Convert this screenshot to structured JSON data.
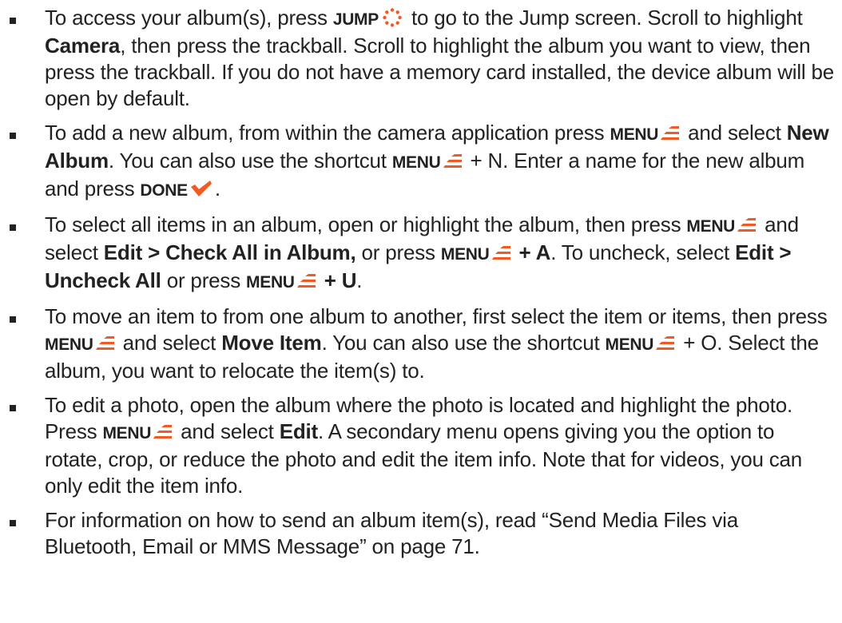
{
  "accent": "#f15a22",
  "icons": {
    "jump": "jump-dots-icon",
    "menu": "menu-lines-icon",
    "done": "checkmark-icon"
  },
  "bullets": [
    {
      "t1": "To access your album(s), press ",
      "k1": "JUMP",
      "t2": " to go to the Jump screen. Scroll to highlight ",
      "b1": "Camera",
      "t3": ", then press the trackball. Scroll to highlight the album you want to view, then press the trackball. If you do not have a memory card installed, the device album will be open by default."
    },
    {
      "t1": "To add a new album, from within the camera application press ",
      "k1": "MENU",
      "t2": " and select ",
      "b1": "New Album",
      "t3": ". You can also use the shortcut ",
      "k2": "MENU",
      "t4": " + N. Enter a name for the new album and  press ",
      "k3": "DONE",
      "t5": "."
    },
    {
      "t1": "To select all items in an album, open or highlight the album, then press ",
      "k1": "MENU",
      "t2": " and select ",
      "b1": "Edit > Check All in Album,",
      "t3": " or press ",
      "k2": "MENU",
      "b2": " + A",
      "t4": ". To uncheck, select ",
      "b3": "Edit > Uncheck All",
      "t5": " or press ",
      "k3": "MENU",
      "b4": " + U",
      "t6": "."
    },
    {
      "t1": "To move an item to from one album to another, first select the item or items,  then press ",
      "k1": "MENU",
      "t2": " and select ",
      "b1": "Move Item",
      "t3": ". You can also use the shortcut ",
      "k2": "MENU",
      "t4": " + O. Select the album, you want to relocate the item(s) to."
    },
    {
      "t1": "To edit a photo, open the album where the photo is located and highlight the photo. Press ",
      "k1": "MENU",
      "t2": " and select ",
      "b1": "Edit",
      "t3": ". A secondary menu opens giving you the option to rotate, crop, or reduce the photo and edit the item info. Note that for videos, you can only edit the item info."
    },
    {
      "t1": "For information on how to send an album item(s), read “Send Media Files via Bluetooth, Email or MMS Message” on page 71."
    }
  ]
}
